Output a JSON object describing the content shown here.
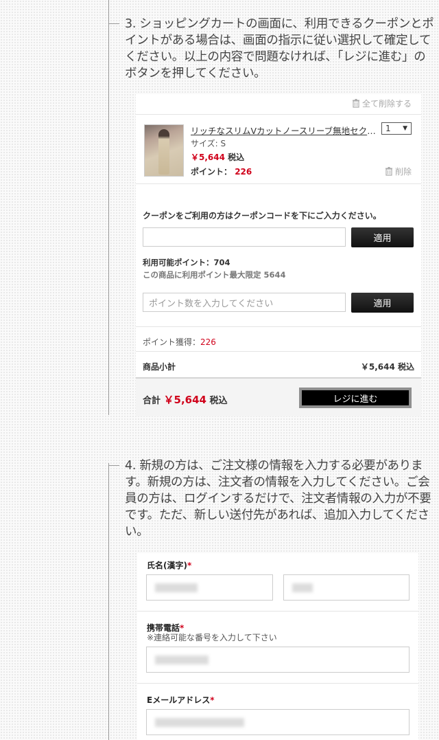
{
  "step3": {
    "text": "3. ショッピングカートの画面に、利用できるクーポンとポイントがある場合は、画面の指示に従い選択して確定してください。以上の内容で問題なければ、「レジに進む」のボタンを押してください。"
  },
  "cart": {
    "delete_all_label": "全て削除する",
    "product": {
      "name": "リッチなスリムVカットノースリーブ無地セクシー",
      "quantity": "1",
      "size": "サイズ: S",
      "price": "￥5,644",
      "tax_label": "税込",
      "points_label": "ポイント：",
      "points_value": "226",
      "delete_label": "削除"
    },
    "coupon_label": "クーポンをご利用の方はクーポンコードを下にご入力ください。",
    "coupon_input_value": "",
    "apply_label": "適用",
    "available_points_label": "利用可能ポイント：704",
    "max_points_label": "この商品に利用ポイント最大限定 5644",
    "points_input_placeholder": "ポイント数を入力してください",
    "earn_label": "ポイント獲得：",
    "earn_value": "226",
    "subtotal_label": "商品小計",
    "subtotal_value": "￥5,644 税込",
    "total_label": "合計",
    "total_amount": "￥5,644",
    "total_tax": "税込",
    "checkout_label": "レジに進む"
  },
  "step4": {
    "text": "4. 新規の方は、ご注文様の情報を入力する必要があります。新規の方は、注文者の情報を入力してください。ご会員の方は、ログインするだけで、注文者情報の入力が不要です。ただ、新しい送付先があれば、追加入力してください。"
  },
  "form": {
    "name_label": "氏名(漢字)",
    "phone_label": "携帯電話",
    "phone_note": "※連絡可能な番号を入力して下さい",
    "email_label": "Eメールアドレス",
    "required_mark": "*"
  },
  "icons": {
    "trash": "trash-icon",
    "dropdown": "dropdown-arrow-icon"
  },
  "colors": {
    "accent_red": "#d0021b",
    "button_dark": "#1a1a1a"
  }
}
